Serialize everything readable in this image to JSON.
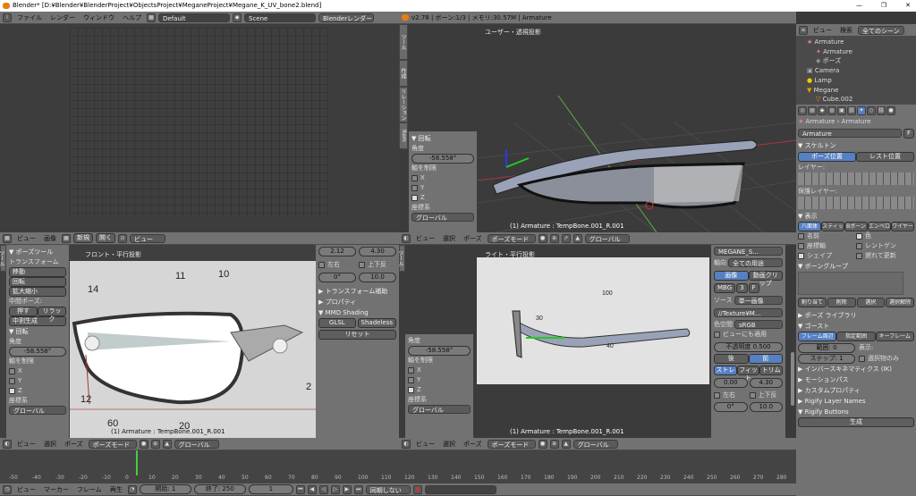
{
  "titlebar": {
    "title": "Blender* [D:¥Blender¥BlenderProject¥ObjectsProject¥MeganeProject¥Megane_K_UV_bone2.blend]"
  },
  "infobar": {
    "menus": [
      "ファイル",
      "レンダー",
      "ウィンドウ",
      "ヘルプ"
    ],
    "layout": "Default",
    "scene": "Scene",
    "engine": "Blenderレンダー",
    "stats": "v2.78 | ボーン:1/3 | メモリ:30.57M | Armature"
  },
  "top_right_view": {
    "label": "ユーザー・透視投影",
    "footer": "(1) Armature : TempBone.001_R.001"
  },
  "top_left_toolshelf": {
    "tabs": [
      "ツール",
      "作成",
      "リレーション"
    ],
    "tab4": "Item",
    "rotate_title": "▼ 回転",
    "angle_label": "角度",
    "angle": "-58.558°",
    "axis_label": "軸を制限",
    "axes": [
      "X",
      "Y",
      "Z"
    ],
    "coord_label": "座標系",
    "coord": "グローバル"
  },
  "editor_header": {
    "view": "ビュー",
    "select": "選択",
    "pose": "ポーズ",
    "mode": "ポーズモード",
    "orient": "グローバル",
    "image": "画像",
    "new": "新規",
    "open": "開く"
  },
  "front_view": {
    "label": "フロント・平行投影",
    "footer": "(1) Armature : TempBone.001_R.001",
    "annots": [
      "14",
      "11",
      "10",
      "12",
      "60",
      "20",
      "2"
    ]
  },
  "pose_tools": {
    "title": "▼ ポーズツール",
    "transform": "トランスフォーム",
    "move": "移動",
    "rotate": "回転",
    "scale": "拡大縮小",
    "in_between": "中間ポーズ:",
    "push": "押す",
    "relax": "リラック",
    "breakdown": "中割生成",
    "rotate_title": "▼ 回転",
    "angle_label": "角度",
    "angle": "-58.558°",
    "axis_label": "軸を制限",
    "axes": [
      "X",
      "Y",
      "Z"
    ],
    "coord_label": "座標系",
    "coord": "グローバル"
  },
  "mid_props": {
    "f1": "2.12",
    "f2": "4.30",
    "lr": "左右",
    "ud": "上下反",
    "rot": "0°",
    "rot2": "10.0",
    "tform": "▶ トランスフォーム補助",
    "props": "▶ プロパティ",
    "mmd": "▼ MMD Shading",
    "glsl": "GLSL",
    "shadeless": "Shadeless",
    "reset": "リセット"
  },
  "side_view": {
    "label": "ライト・平行投影",
    "footer": "(1) Armature : TempBone.001_R.001",
    "annots": [
      "100",
      "30",
      "40"
    ]
  },
  "tex_panel": {
    "img_name": "MEGANE_S...",
    "use": "全ての用途",
    "image_btn": "画像",
    "movie_btn": "動画クリップ",
    "mbg": "MBG",
    "three": "3",
    "F": "F",
    "source_label": "ソース",
    "source": "単一画像",
    "path": "//Texture¥M...",
    "color_label": "色空間",
    "color": "sRGB",
    "view_transform": "ビューにも適用",
    "opacity_label": "不透明度",
    "opacity": "0.500",
    "back": "後",
    "front": "前",
    "stretch": "ストレ",
    "fit": "フィット",
    "crop": "トリム",
    "v1": "0.00",
    "v2": "4.30",
    "lr": "左右",
    "ud": "上下反",
    "rot": "0°",
    "rot2": "10.0"
  },
  "outliner": {
    "view": "ビュー",
    "search": "検索",
    "scenes": "全てのシーン",
    "items": [
      "Armature",
      "Armature",
      "ポーズ",
      "Camera",
      "Lamp",
      "Megane",
      "Cube.002"
    ]
  },
  "props": {
    "armature": "Armature",
    "data_name": "Armature",
    "f": "F",
    "skeleton": "▼ スケルトン",
    "pose_pos": "ポーズ位置",
    "rest_pos": "レスト位置",
    "layers": "レイヤー:",
    "prot_layers": "保護レイヤー:",
    "display": "▼ 表示",
    "disp_tabs": [
      "八面体",
      "スティッ",
      "Bボーン",
      "エンベロ",
      "ワイヤー"
    ],
    "names": "名前",
    "colors": "色",
    "axes": "座標軸",
    "xray": "レントゲン",
    "shape": "シェイプ",
    "delay": "遅れて更新",
    "bone_groups": "▼ ボーングループ",
    "assign": "割り当て",
    "remove": "削除",
    "select": "選択",
    "deselect": "選択解除",
    "pose_lib": "▶ ポーズ ライブラリ",
    "ghost": "▼ ゴースト",
    "frame_range": "フレーム周辺",
    "in_range": "指定範囲",
    "keyframes": "キーフレーム",
    "range": "範囲:",
    "range_v": "0",
    "step": "ステップ:",
    "step_v": "1",
    "display_lbl": "表示:",
    "sel_only": "選択物のみ",
    "ik": "▶ インバースキネマティクス (IK)",
    "motion": "▶ モーションパス",
    "custom": "▶ カスタムプロパティ",
    "rigify_names": "▶ Rigify Layer Names",
    "rigify_buttons": "▼ Rigify Buttons",
    "generate": "生成"
  },
  "timeline": {
    "ticks": [
      "-50",
      "-40",
      "-30",
      "-20",
      "-10",
      "0",
      "10",
      "20",
      "30",
      "40",
      "50",
      "60",
      "70",
      "80",
      "90",
      "100",
      "110",
      "120",
      "130",
      "140",
      "150",
      "160",
      "170",
      "180",
      "190",
      "200",
      "210",
      "220",
      "230",
      "240",
      "250",
      "260",
      "270",
      "280"
    ],
    "view": "ビュー",
    "marker": "マーカー",
    "frame": "フレーム",
    "playback": "再生",
    "start_label": "開始:",
    "start": "1",
    "end_label": "終了:",
    "end": "250",
    "current": "1",
    "sync": "同期しない"
  }
}
